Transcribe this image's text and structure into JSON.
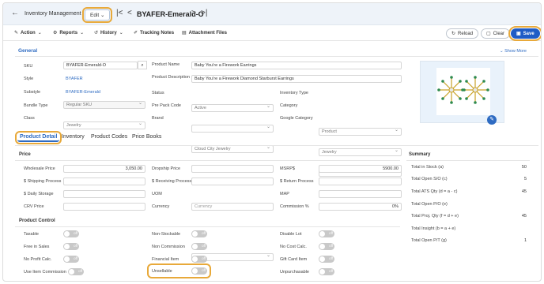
{
  "header": {
    "app_title": "Inventory Management",
    "edit_label": "Edit",
    "record_title": "BYAFER-Emerald-O"
  },
  "toolbar": {
    "action": "Action",
    "reports": "Reports",
    "history": "History",
    "tracking_notes": "Tracking Notes",
    "attachment_files": "Attachment Files",
    "reload": "Reload",
    "clear": "Clear",
    "save": "Save"
  },
  "general": {
    "title": "General",
    "show_more": "Show More",
    "sku_label": "SKU",
    "sku_value": "BYAFER-Emerald-O",
    "style_label": "Style",
    "style_value": "BYAFER",
    "substyle_label": "Substyle",
    "substyle_value": "BYAFER-Emerald",
    "bundle_type_label": "Bundle Type",
    "bundle_type_value": "Regular SKU",
    "class_label": "Class",
    "class_value": "Jewelry",
    "product_name_label": "Product Name",
    "product_name_value": "Baby You're a Firework Earrings",
    "product_desc_label": "Product Description",
    "product_desc_value": "Baby You're a Firework Diamond Starburst Earrings",
    "status_label": "Status",
    "status_value": "Active",
    "pre_pack_label": "Pre Pack Code",
    "pre_pack_value": "",
    "brand_label": "Brand",
    "brand_value": "Cloud City Jewelry",
    "inventory_type_label": "Inventory Type",
    "inventory_type_value": "Product",
    "category_label": "Category",
    "category_value": "Jewelry",
    "google_category_label": "Google Category",
    "google_category_value": ""
  },
  "tabs": [
    "Product Detail",
    "Inventory",
    "Product Codes",
    "Price Books"
  ],
  "price": {
    "title": "Price",
    "wholesale_label": "Wholesale Price",
    "wholesale_value": "3,050.00",
    "shipping_label": "$ Shipping Process",
    "shipping_value": "",
    "daily_storage_label": "$ Daily Storage",
    "daily_storage_value": "",
    "crv_label": "CRV Price",
    "crv_value": "",
    "dropship_label": "Dropship Price",
    "dropship_value": "",
    "receiving_label": "$ Receiving Process",
    "receiving_value": "",
    "uom_label": "UOM",
    "uom_value": "",
    "currency_label": "Currency",
    "currency_placeholder": "Currency",
    "msrp_label": "MSRP$",
    "msrp_value": "5900.00",
    "return_label": "$ Return Process",
    "return_value": "",
    "map_label": "MAP",
    "map_value": "",
    "commission_label": "Commission %",
    "commission_value": "0%"
  },
  "product_control": {
    "title": "Product Control",
    "off": "off",
    "taxable": "Taxable",
    "free_in_sales": "Free in Sales",
    "no_profit": "No Profit Calc.",
    "use_item_commission": "Use Item Commission",
    "non_stockable": "Non-Stockable",
    "non_commission": "Non Commission",
    "financial_item": "Financial Item",
    "unsellable": "Unsellable",
    "disable_lot": "Disable Lot",
    "no_cost_calc": "No Cost Calc.",
    "gift_card_item": "Gift Card Item",
    "unpurchasable": "Unpurchasable"
  },
  "summary": {
    "title": "Summary",
    "rows": [
      {
        "label": "Total in Stock (a)",
        "value": "50"
      },
      {
        "label": "Total Open S/O (c)",
        "value": "5"
      },
      {
        "label": "Total ATS Qty (d = a - c)",
        "value": "45"
      },
      {
        "label": "Total Open P/O (e)",
        "value": ""
      },
      {
        "label": "Total Proj. Qty (f = d + e)",
        "value": "45"
      },
      {
        "label": "Total Insight (b = a + e)",
        "value": ""
      },
      {
        "label": "Total Open P/T (g)",
        "value": "1"
      }
    ]
  },
  "colors": {
    "accent": "#2e6bc2",
    "save": "#1f5cc6",
    "highlight": "#e8a93a"
  }
}
